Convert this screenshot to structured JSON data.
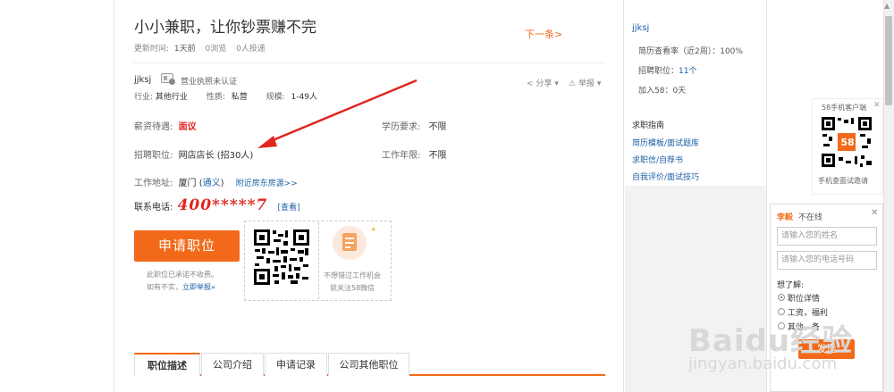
{
  "job": {
    "title": "小小兼职，让你钞票赚不完",
    "update_label": "更新时间:",
    "update_value": "1天前",
    "views": "0浏览",
    "applied": "0人投递",
    "next_label": "下一条>"
  },
  "company": {
    "name": "jjksj",
    "license": "营业执照未认证",
    "industry_label": "行业:",
    "industry_value": "其他行业",
    "nature_label": "性质:",
    "nature_value": "私营",
    "scale_label": "规模:",
    "scale_value": "1-49人",
    "share": "分享",
    "report": "举报"
  },
  "details": {
    "salary_label": "薪资待遇:",
    "salary_value": "面议",
    "education_label": "学历要求:",
    "education_value": "不限",
    "position_label": "招聘职位:",
    "position_value": "网店店长 (招30人)",
    "experience_label": "工作年限:",
    "experience_value": "不限",
    "address_label": "工作地址:",
    "address_value_pre": "厦门 (",
    "address_link": "通义",
    "address_value_post": ")",
    "nearby_link": "附近房东房源>>",
    "phone_label": "联系电话:",
    "phone_value": "400*****7",
    "phone_view": "[查看]"
  },
  "apply": {
    "button": "申请职位",
    "note_line1": "此职位已承诺不收费。",
    "note_line2_pre": "如有不实，",
    "note_line2_link": "立即举报»"
  },
  "wechat": {
    "line1": "不想错过工作机会",
    "line2": "就关注58微信"
  },
  "tabs": [
    "职位描述",
    "公司介绍",
    "申请记录",
    "公司其他职位"
  ],
  "sidebar": {
    "company": "jjksj",
    "resume_rate": "简历查看率（近2周）：100%",
    "positions_label": "招聘职位：",
    "positions_value": "11个",
    "joined": "加入58：0天",
    "guide_title": "求职指南",
    "links": [
      "简历模板/面试题库",
      "求职信/自荐书",
      "自我评价/面试技巧"
    ]
  },
  "app_ad": {
    "title": "58手机客户端",
    "badge": "58",
    "caption": "手机查面试邀请"
  },
  "chat": {
    "name": "李毅",
    "status": "不在线",
    "name_placeholder": "请输入您的姓名",
    "phone_placeholder": "请输入您的电话号码",
    "want_label": "想了解:",
    "options": [
      "职位详情",
      "工资，福利",
      "其他，备"
    ],
    "send": "发送"
  },
  "watermark": {
    "logo": "Baidu经验",
    "url": "jingyan.baidu.com"
  },
  "colors": {
    "accent": "#f26a19",
    "link": "#1b5fa6",
    "alert": "#e0251f"
  }
}
